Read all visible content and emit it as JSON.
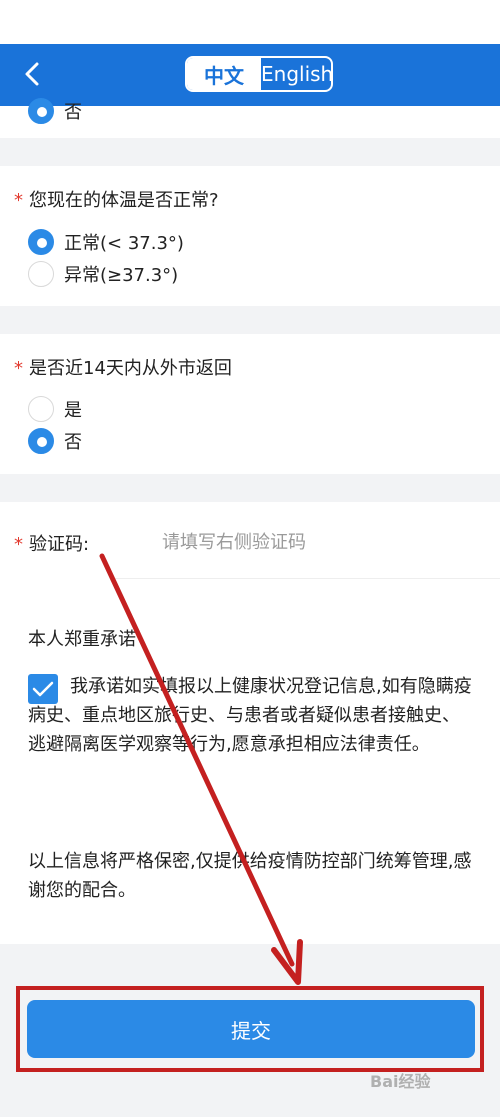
{
  "header": {
    "back_icon": "chevron-left-icon",
    "lang_zh": "中文",
    "lang_en": "English"
  },
  "q0": {
    "option_no": "否"
  },
  "q1": {
    "title": "您现在的体温是否正常?",
    "options": [
      "正常(< 37.3°)",
      "异常(≥37.3°)"
    ],
    "selected": 0
  },
  "q2": {
    "title": "是否近14天内从外市返回",
    "options": [
      "是",
      "否"
    ],
    "selected": 1
  },
  "captcha": {
    "label": "验证码:",
    "placeholder": "请填写右侧验证码"
  },
  "pledge": {
    "title": "本人郑重承诺",
    "text": "我承诺如实填报以上健康状况登记信息,如有隐瞒疫病史、重点地区旅行史、与患者或者疑似患者接触史、逃避隔离医学观察等行为,愿意承担相应法律责任。",
    "checked": true
  },
  "notice": "以上信息将严格保密,仅提供给疫情防控部门统筹管理,感谢您的配合。",
  "submit_label": "提交",
  "watermark": "Bai经验",
  "colors": {
    "header": "#1a73d9",
    "accent": "#2b8ae6",
    "annotation": "#c42020"
  }
}
